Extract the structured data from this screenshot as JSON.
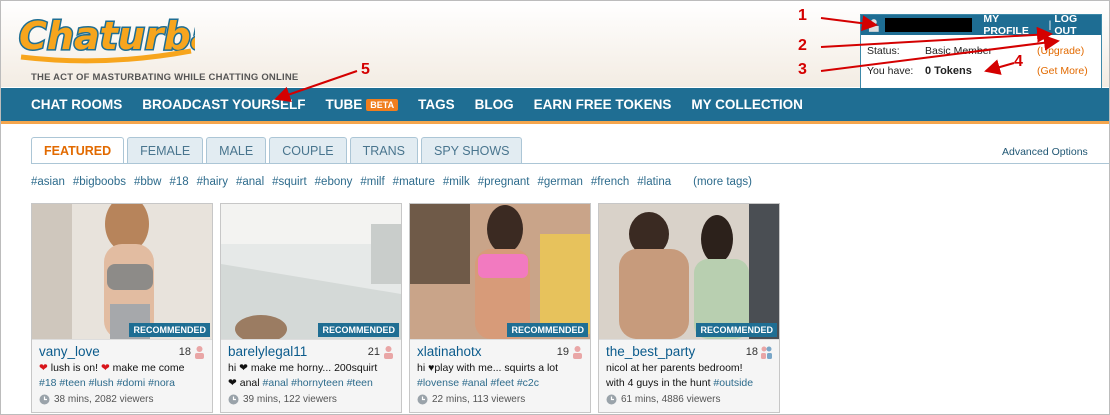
{
  "header": {
    "logo_text": "Chaturbate",
    "tagline": "THE ACT OF MASTURBATING WHILE CHATTING ONLINE",
    "user_links": {
      "profile": "MY PROFILE",
      "separator": "|",
      "logout": "LOG OUT"
    },
    "status": {
      "label": "Status:",
      "value": "Basic Member",
      "action": "(Upgrade)"
    },
    "tokens": {
      "label": "You have:",
      "value": "0 Tokens",
      "action": "(Get More)"
    }
  },
  "nav": {
    "items": [
      "CHAT ROOMS",
      "BROADCAST YOURSELF",
      "TUBE",
      "TAGS",
      "BLOG",
      "EARN FREE TOKENS",
      "MY COLLECTION"
    ],
    "beta_badge": "BETA"
  },
  "tabs": {
    "items": [
      "FEATURED",
      "FEMALE",
      "MALE",
      "COUPLE",
      "TRANS",
      "SPY SHOWS"
    ],
    "active": "FEATURED",
    "advanced": "Advanced Options"
  },
  "tags": {
    "items": [
      "#asian",
      "#bigboobs",
      "#bbw",
      "#18",
      "#hairy",
      "#anal",
      "#squirt",
      "#ebony",
      "#milf",
      "#mature",
      "#milk",
      "#pregnant",
      "#german",
      "#french",
      "#latina"
    ],
    "more": "(more tags)"
  },
  "badge_label": "RECOMMENDED",
  "rooms": [
    {
      "name": "vany_love",
      "age": "18",
      "gender": "female",
      "subject_line1": [
        "lush is on!",
        "make me come"
      ],
      "subject_tags": "#18 #teen #lush #domi #nora",
      "meta": "38 mins, 2082 viewers"
    },
    {
      "name": "barelylegal11",
      "age": "21",
      "gender": "female",
      "subject_line1": [
        "hi",
        "make me horny... 200squirt"
      ],
      "subject_line2_prefix": "anal",
      "subject_tags": "#anal #hornyteen #teen",
      "meta": "39 mins, 122 viewers"
    },
    {
      "name": "xlatinahotx",
      "age": "19",
      "gender": "female",
      "subject_line1": [
        "hi",
        "play with me... squirts a lot"
      ],
      "subject_tags": "#lovense #anal #feet #c2c",
      "meta": "22 mins, 113 viewers"
    },
    {
      "name": "the_best_party",
      "age": "18",
      "gender": "couple",
      "subject_line1": [
        "nicol at her parents bedroom!"
      ],
      "subject_line2_prefix": "with 4 guys in the hunt",
      "subject_tags": "#outside",
      "meta": "61 mins, 4886 viewers"
    }
  ],
  "annotations": [
    "1",
    "2",
    "3",
    "4",
    "5"
  ],
  "colors": {
    "nav": "#1f6e93",
    "accent": "#f07e1e",
    "link": "#2d6b8c",
    "annotation": "#d40000"
  }
}
